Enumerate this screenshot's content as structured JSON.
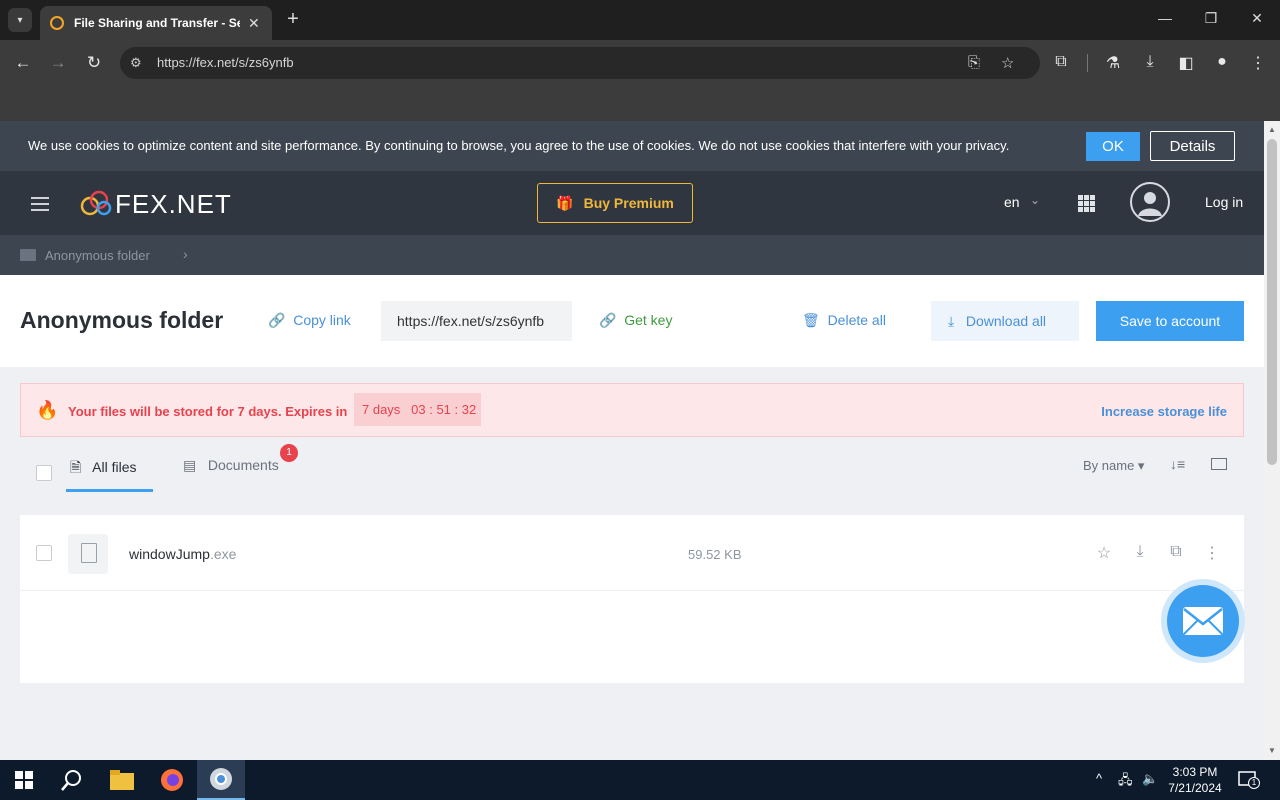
{
  "browser": {
    "tab_title": "File Sharing and Transfer - Sen",
    "url": "https://fex.net/s/zs6ynfb"
  },
  "cookie_banner": {
    "text": "We use cookies to optimize content and site performance. By continuing to browse, you agree to the use of cookies. We do not use cookies that interfere with your privacy.",
    "ok_label": "OK",
    "details_label": "Details"
  },
  "header": {
    "logo": "FEX.NET",
    "buy_premium_label": "Buy Premium",
    "language": "en",
    "login_label": "Log in"
  },
  "breadcrumb": {
    "folder": "Anonymous folder"
  },
  "folder_bar": {
    "title": "Anonymous folder",
    "copy_link_label": "Copy link",
    "share_url": "https://fex.net/s/zs6ynfb",
    "get_key_label": "Get key",
    "delete_all_label": "Delete all",
    "download_all_label": "Download all",
    "save_to_account_label": "Save to account"
  },
  "storage_notice": {
    "text": "Your files will be stored for 7 days. Expires in",
    "countdown_days": "7 days",
    "countdown_time": "03 : 51 : 32",
    "increase_label": "Increase storage life"
  },
  "file_tabs": {
    "all_files": "All files",
    "documents": "Documents",
    "documents_badge": "1",
    "sort_label": "By name"
  },
  "files": [
    {
      "name": "windowJump",
      "ext": ".exe",
      "size": "59.52 KB"
    }
  ],
  "taskbar": {
    "time": "3:03 PM",
    "date": "7/21/2024",
    "notification_count": "1"
  },
  "colors": {
    "accent": "#3c9ff0",
    "premium": "#f0b73a",
    "danger": "#e8424d",
    "header_bg": "#2f3640"
  }
}
